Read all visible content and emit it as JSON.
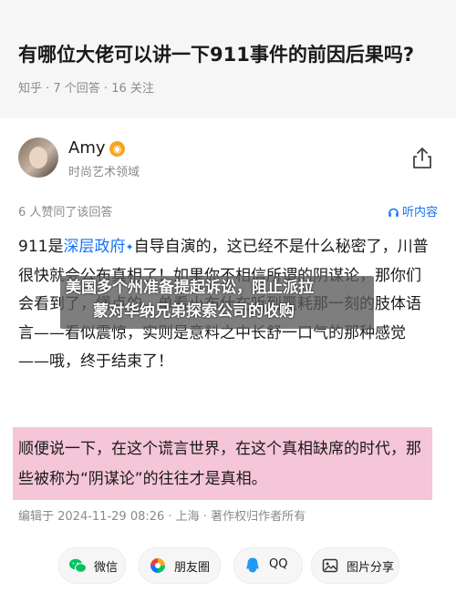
{
  "question": {
    "title": "有哪位大佬可以讲一下911事件的前因后果吗?",
    "meta": "知乎 · 7 个回答 · 16 关注"
  },
  "author": {
    "name": "Amy",
    "description": "时尚艺术领域"
  },
  "stats": {
    "summary": "6 人赞同了该回答",
    "listen_label": "听内容"
  },
  "answer": {
    "part1": "911是",
    "link_text": "深层政府",
    "part2": "自导自演的，这已经不是什么秘密了，川普很快就会公布真相了！如果你不相信所谓的阴谋论，那你们会看到了，懂点的，单看小布什在听到噩耗那一刻的肢体语言——看似震惊，实则是意料之中长舒一口气的那种感觉——哦，终于结束了！"
  },
  "overlay": {
    "line1": "美国多个州准备提起诉讼，阻止派拉",
    "line2": "蒙对华纳兄弟探索公司的收购"
  },
  "highlight": {
    "text": "顺便说一下，在这个谎言世界，在这个真相缺席的时代，那些被称为“阴谋论”的往往才是真相。"
  },
  "footer": {
    "meta": "编辑于 2024-11-29 08:26 · 上海 · 著作权归作者所有"
  },
  "share": {
    "wechat": "微信",
    "moments": "朋友圈",
    "qq": "QQ",
    "image_share": "图片分享"
  },
  "colors": {
    "accent": "#1772f6",
    "highlight": "#f5c6d8",
    "header_bg": "#f6f6f6"
  },
  "icons": [
    "share-icon",
    "headphones-icon",
    "wechat-icon",
    "moments-icon",
    "qq-icon",
    "image-share-icon",
    "verified-badge-icon"
  ]
}
